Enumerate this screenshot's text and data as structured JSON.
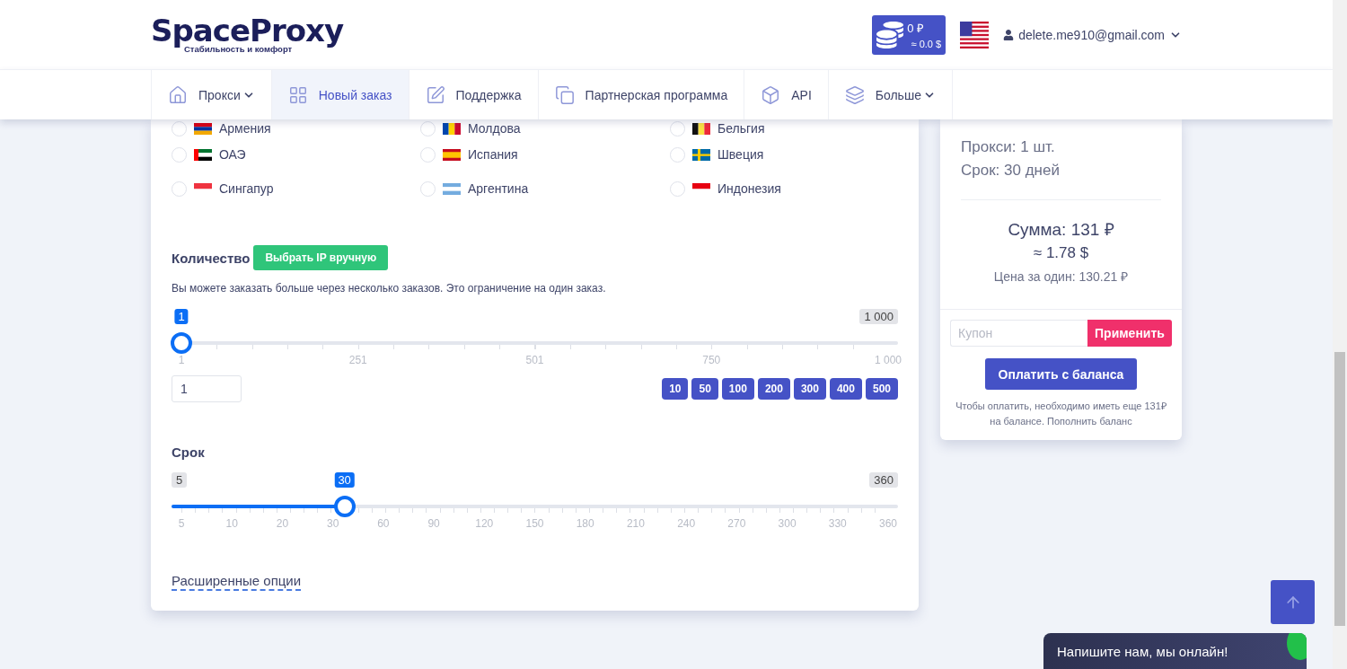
{
  "header": {
    "logo": {
      "name": "SpaceProxy",
      "tagline": "Стабильность и комфорт"
    },
    "balance": {
      "rub": "0 ₽",
      "usd": "≈ 0.0 $"
    },
    "user": {
      "email": "delete.me910@gmail.com"
    }
  },
  "nav": [
    {
      "label": "Прокси",
      "dropdown": true,
      "selected": false
    },
    {
      "label": "Новый заказ",
      "dropdown": false,
      "selected": true
    },
    {
      "label": "Поддержка",
      "dropdown": false,
      "selected": false
    },
    {
      "label": "Партнерская программа",
      "dropdown": false,
      "selected": false
    },
    {
      "label": "API",
      "dropdown": false,
      "selected": false
    },
    {
      "label": "Больше",
      "dropdown": true,
      "selected": false
    }
  ],
  "countries": [
    {
      "name": "Армения",
      "selected": false
    },
    {
      "name": "Молдова",
      "selected": false
    },
    {
      "name": "Бельгия",
      "selected": false
    },
    {
      "name": "ОАЭ",
      "selected": false
    },
    {
      "name": "Испания",
      "selected": false
    },
    {
      "name": "Швеция",
      "selected": false
    },
    {
      "name": "Сингапур",
      "selected": false
    },
    {
      "name": "Аргентина",
      "selected": false
    },
    {
      "name": "Индонезия",
      "selected": false
    }
  ],
  "quantity": {
    "title": "Количество",
    "manual_button": "Выбрать IP вручную",
    "note": "Вы можете заказать больше через несколько заказов. Это ограничение на один заказ.",
    "slider": {
      "value": "1",
      "max": "1 000",
      "level": 0,
      "ticks": [
        "1",
        "251",
        "501",
        "750",
        "1 000"
      ]
    },
    "input": "1",
    "presets": [
      "10",
      "50",
      "100",
      "200",
      "300",
      "400",
      "500"
    ]
  },
  "period": {
    "title": "Срок",
    "slider": {
      "min": "5",
      "max": "360",
      "value": "30",
      "level": 0.2308,
      "ticks": [
        "5",
        "10",
        "20",
        "30",
        "60",
        "90",
        "120",
        "150",
        "180",
        "210",
        "240",
        "270",
        "300",
        "330",
        "360"
      ]
    }
  },
  "advanced_link": "Расширенные опции",
  "summary": {
    "proxies": "Прокси: 1 шт.",
    "period": "Срок: 30 дней",
    "total": "Сумма: 131 ₽",
    "total_usd": "≈ 1.78 $",
    "unit_price": "Цена за один: 130.21 ₽",
    "coupon_placeholder": "Купон",
    "apply_button": "Применить",
    "pay_button": "Оплатить с баланса",
    "note": "Чтобы оплатить, необходимо иметь еще 131₽ на балансе.",
    "topup_link": "Пополнить баланс"
  },
  "chat": {
    "text": "Напишите нам, мы онлайн!"
  }
}
